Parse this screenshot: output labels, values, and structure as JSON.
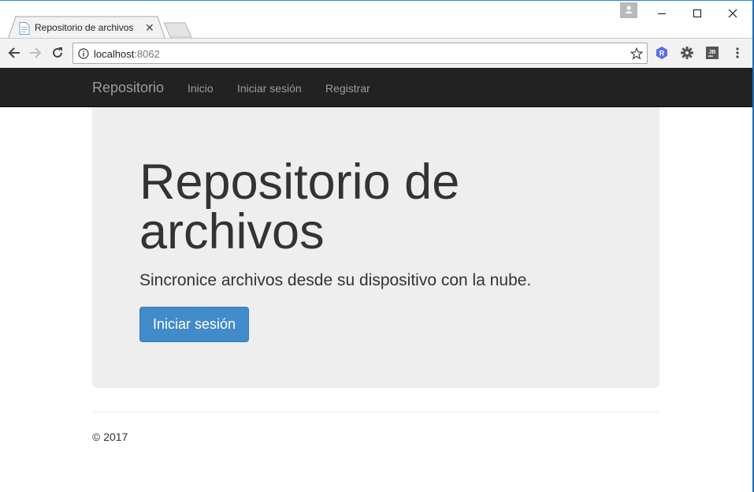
{
  "browser": {
    "tab_title": "Repositorio de archivos",
    "tab_close": "✕",
    "url_host": "localhost",
    "url_port": ":8062"
  },
  "site": {
    "brand": "Repositorio",
    "nav": [
      "Inicio",
      "Iniciar sesión",
      "Registrar"
    ]
  },
  "jumbotron": {
    "title": "Repositorio de archivos",
    "lead": "Sincronice archivos desde su dispositivo con la nube.",
    "button": "Iniciar sesión",
    "button_color": "#428bca"
  },
  "footer": {
    "text": "© 2017"
  }
}
